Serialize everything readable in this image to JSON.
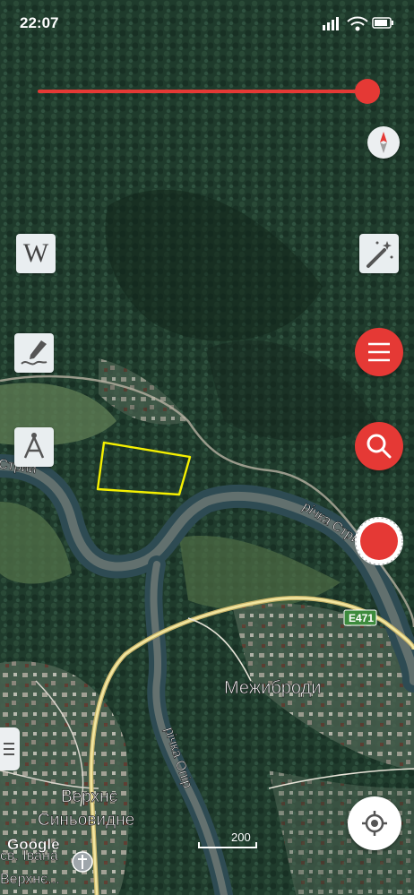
{
  "status_bar": {
    "time": "22:07"
  },
  "map": {
    "labels": {
      "river_stryi": "річка Стрий",
      "river_opir": "річка Опір",
      "village_mezhybrody": "Межиброди",
      "village_verkhne_line1": "Верхнє",
      "village_verkhne_line2": "Синьовидне",
      "church_line1": "св. Івана",
      "church_line2": "Верхнє...",
      "stryi_edge": "Стрий",
      "road_badge": "E471",
      "google_logo": "Google",
      "scale_value": "200"
    },
    "highlight_color": "#f5f000"
  },
  "controls": {
    "slider_level": 1.0,
    "slider_color": "#e53935",
    "accent_color": "#e53935",
    "wikipedia_button": "W",
    "icons": [
      "compass-icon",
      "magic-wand-icon",
      "menu-icon",
      "search-icon",
      "record-icon",
      "drawing-icon",
      "measure-compass-icon",
      "my-location-icon",
      "side-menu-icon"
    ]
  }
}
